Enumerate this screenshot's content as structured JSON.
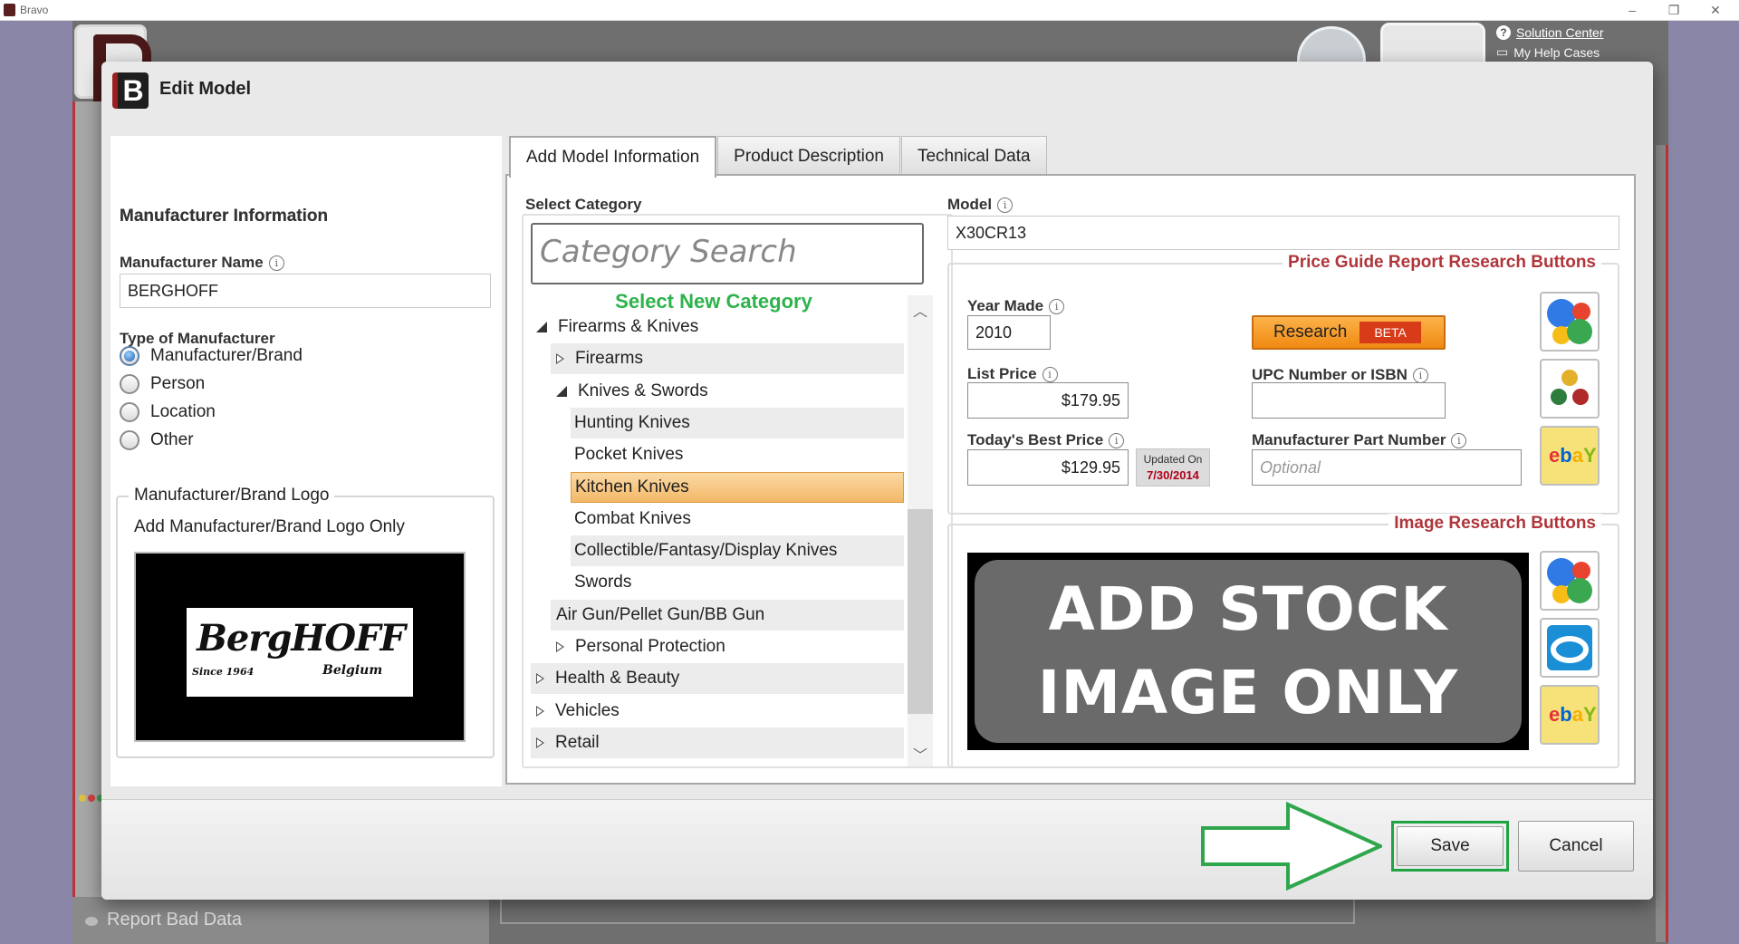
{
  "os": {
    "title": "Bravo",
    "controls": [
      "–",
      "❐",
      "✕"
    ]
  },
  "background": {
    "help_links": [
      "Solution Center",
      "My Help Cases"
    ],
    "report_bad_data": "Report Bad Data"
  },
  "dialog": {
    "title": "Edit Model",
    "manufacturer": {
      "heading": "Manufacturer Information",
      "name_label": "Manufacturer Name",
      "name_value": "BERGHOFF",
      "type_label": "Type of Manufacturer",
      "types": [
        {
          "label": "Manufacturer/Brand",
          "checked": true
        },
        {
          "label": "Person",
          "checked": false
        },
        {
          "label": "Location",
          "checked": false
        },
        {
          "label": "Other",
          "checked": false
        }
      ],
      "logo_legend": "Manufacturer/Brand Logo",
      "logo_sub": "Add Manufacturer/Brand Logo Only",
      "logo": {
        "brand": "BergHOFF",
        "since": "Since 1964",
        "country": "Belgium"
      }
    },
    "tabs": [
      {
        "label": "Add Model Information",
        "active": true
      },
      {
        "label": "Product Description",
        "active": false
      },
      {
        "label": "Technical Data",
        "active": false
      }
    ],
    "category": {
      "label": "Select Category",
      "search_placeholder": "Category Search",
      "select_new": "Select New Category",
      "tree": [
        {
          "label": "Firearms & Knives",
          "level": 0,
          "state": "open",
          "shade": false,
          "selected": false
        },
        {
          "label": "Firearms",
          "level": 1,
          "state": "closed",
          "shade": true,
          "selected": false
        },
        {
          "label": "Knives & Swords",
          "level": 1,
          "state": "open",
          "shade": false,
          "selected": false
        },
        {
          "label": "Hunting Knives",
          "level": 2,
          "state": "leaf",
          "shade": true,
          "selected": false
        },
        {
          "label": "Pocket Knives",
          "level": 2,
          "state": "leaf",
          "shade": false,
          "selected": false
        },
        {
          "label": "Kitchen Knives",
          "level": 2,
          "state": "leaf",
          "shade": false,
          "selected": true
        },
        {
          "label": "Combat Knives",
          "level": 2,
          "state": "leaf",
          "shade": false,
          "selected": false
        },
        {
          "label": "Collectible/Fantasy/Display Knives",
          "level": 2,
          "state": "leaf",
          "shade": true,
          "selected": false
        },
        {
          "label": "Swords",
          "level": 2,
          "state": "leaf",
          "shade": false,
          "selected": false
        },
        {
          "label": "Air Gun/Pellet Gun/BB Gun",
          "level": 1,
          "state": "leaf",
          "shade": true,
          "selected": false
        },
        {
          "label": "Personal Protection",
          "level": 1,
          "state": "closed",
          "shade": false,
          "selected": false
        },
        {
          "label": "Health & Beauty",
          "level": 0,
          "state": "closed",
          "shade": true,
          "selected": false
        },
        {
          "label": "Vehicles",
          "level": 0,
          "state": "closed",
          "shade": false,
          "selected": false
        },
        {
          "label": "Retail",
          "level": 0,
          "state": "closed",
          "shade": true,
          "selected": false
        }
      ]
    },
    "model": {
      "label": "Model",
      "value": "X30CR13"
    },
    "price_guide": {
      "title": "Price Guide Report Research Buttons",
      "year_label": "Year Made",
      "year_value": "2010",
      "list_label": "List Price",
      "list_value": "$179.95",
      "best_label": "Today's Best Price",
      "best_value": "$129.95",
      "updated_label": "Updated On",
      "updated_date": "7/30/2014",
      "research_label": "Research",
      "beta_label": "BETA",
      "upc_label": "UPC Number or ISBN",
      "upc_value": "",
      "mpn_label": "Manufacturer Part Number",
      "mpn_placeholder": "Optional"
    },
    "image_research": {
      "title": "Image Research Buttons",
      "stock_line1": "ADD STOCK",
      "stock_line2": "IMAGE ONLY"
    },
    "buttons": {
      "save": "Save",
      "cancel": "Cancel"
    },
    "colors": {
      "accent_red": "#b0353a",
      "green": "#2db34a",
      "orange": "#f08a12",
      "selected": "#f3b868"
    }
  }
}
